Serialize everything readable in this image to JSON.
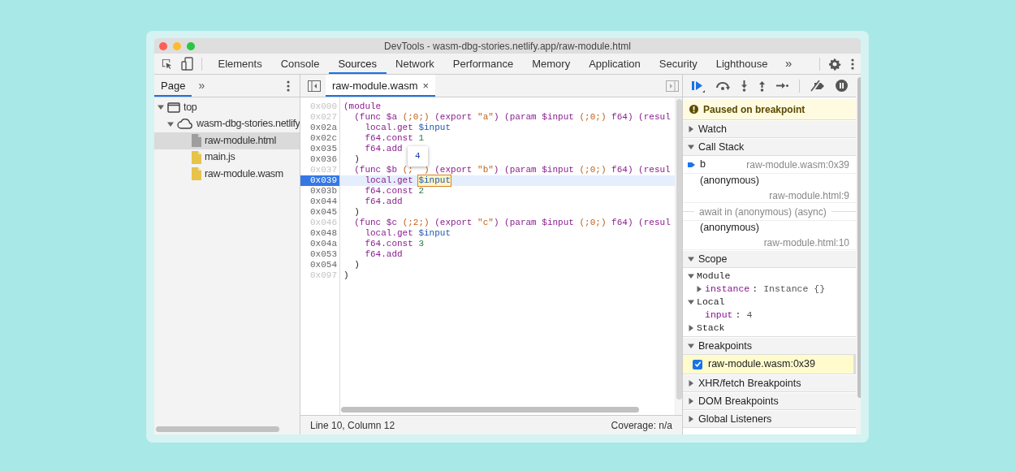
{
  "window": {
    "title": "DevTools - wasm-dbg-stories.netlify.app/raw-module.html"
  },
  "main_tabs": [
    {
      "label": "Elements",
      "selected": false
    },
    {
      "label": "Console",
      "selected": false
    },
    {
      "label": "Sources",
      "selected": true
    },
    {
      "label": "Network",
      "selected": false
    },
    {
      "label": "Performance",
      "selected": false
    },
    {
      "label": "Memory",
      "selected": false
    },
    {
      "label": "Application",
      "selected": false
    },
    {
      "label": "Security",
      "selected": false
    },
    {
      "label": "Lighthouse",
      "selected": false
    }
  ],
  "main_tabs_more": "»",
  "navigator": {
    "tabs": [
      {
        "label": "Page",
        "selected": true
      }
    ],
    "more": "»",
    "tree": [
      {
        "label": "top",
        "kind": "frame",
        "expanded": true,
        "selected": false,
        "children": [
          {
            "label": "wasm-dbg-stories.netlify",
            "kind": "domain",
            "expanded": true,
            "selected": false,
            "children": [
              {
                "label": "raw-module.html",
                "kind": "file",
                "color": "#9e9e9e",
                "selected": true
              },
              {
                "label": "main.js",
                "kind": "file",
                "color": "#e8c34a",
                "selected": false
              },
              {
                "label": "raw-module.wasm",
                "kind": "file",
                "color": "#e8c34a",
                "selected": false
              }
            ]
          }
        ]
      }
    ]
  },
  "editor": {
    "tabs": [
      {
        "label": "raw-module.wasm",
        "close": "×",
        "selected": true
      }
    ],
    "lines": [
      {
        "address": "0x000",
        "breakable": false,
        "current": false,
        "tokens": [
          {
            "text": "(module",
            "kind": "keyword"
          }
        ]
      },
      {
        "address": "0x027",
        "breakable": false,
        "current": false,
        "tokens": [
          {
            "text": "  (func $a ",
            "kind": "keyword"
          },
          {
            "text": "(;0;)",
            "kind": "string"
          },
          {
            "text": " (export ",
            "kind": "keyword"
          },
          {
            "text": "\"a\"",
            "kind": "string"
          },
          {
            "text": ") (param $input ",
            "kind": "keyword"
          },
          {
            "text": "(;0;)",
            "kind": "string"
          },
          {
            "text": " f64) (resul",
            "kind": "keyword"
          }
        ]
      },
      {
        "address": "0x02a",
        "breakable": true,
        "current": false,
        "tokens": [
          {
            "text": "    local.get ",
            "kind": "keyword"
          },
          {
            "text": "$input",
            "kind": "variable"
          }
        ]
      },
      {
        "address": "0x02c",
        "breakable": true,
        "current": false,
        "tokens": [
          {
            "text": "    f64.const ",
            "kind": "keyword"
          },
          {
            "text": "1",
            "kind": "number"
          }
        ]
      },
      {
        "address": "0x035",
        "breakable": true,
        "current": false,
        "tokens": [
          {
            "text": "    f64.add",
            "kind": "keyword"
          }
        ]
      },
      {
        "address": "0x036",
        "breakable": true,
        "current": false,
        "tokens": [
          {
            "text": "  )",
            "kind": "plain"
          }
        ]
      },
      {
        "address": "0x037",
        "breakable": false,
        "current": false,
        "tokens": [
          {
            "text": "  (func $b ",
            "kind": "keyword"
          },
          {
            "text": "(;",
            "kind": "string"
          },
          {
            "text": "4",
            "kind": "value_tooltip"
          },
          {
            "text": ")",
            "kind": "string"
          },
          {
            "text": " (export ",
            "kind": "keyword"
          },
          {
            "text": "\"b\"",
            "kind": "string"
          },
          {
            "text": ") (param $input ",
            "kind": "keyword"
          },
          {
            "text": "(;0;)",
            "kind": "string"
          },
          {
            "text": " f64) (resul",
            "kind": "keyword"
          }
        ]
      },
      {
        "address": "0x039",
        "breakable": true,
        "current": true,
        "tokens": [
          {
            "text": "    local.get ",
            "kind": "keyword"
          },
          {
            "text": "$input",
            "kind": "hovered"
          }
        ]
      },
      {
        "address": "0x03b",
        "breakable": true,
        "current": false,
        "tokens": [
          {
            "text": "    f64.const ",
            "kind": "keyword"
          },
          {
            "text": "2",
            "kind": "number"
          }
        ]
      },
      {
        "address": "0x044",
        "breakable": true,
        "current": false,
        "tokens": [
          {
            "text": "    f64.add",
            "kind": "keyword"
          }
        ]
      },
      {
        "address": "0x045",
        "breakable": true,
        "current": false,
        "tokens": [
          {
            "text": "  )",
            "kind": "plain"
          }
        ]
      },
      {
        "address": "0x046",
        "breakable": false,
        "current": false,
        "tokens": [
          {
            "text": "  (func $c ",
            "kind": "keyword"
          },
          {
            "text": "(;2;)",
            "kind": "string"
          },
          {
            "text": " (export ",
            "kind": "keyword"
          },
          {
            "text": "\"c\"",
            "kind": "string"
          },
          {
            "text": ") (param $input ",
            "kind": "keyword"
          },
          {
            "text": "(;0;)",
            "kind": "string"
          },
          {
            "text": " f64) (resul",
            "kind": "keyword"
          }
        ]
      },
      {
        "address": "0x048",
        "breakable": true,
        "current": false,
        "tokens": [
          {
            "text": "    local.get ",
            "kind": "keyword"
          },
          {
            "text": "$input",
            "kind": "variable"
          }
        ]
      },
      {
        "address": "0x04a",
        "breakable": true,
        "current": false,
        "tokens": [
          {
            "text": "    f64.const ",
            "kind": "keyword"
          },
          {
            "text": "3",
            "kind": "number"
          }
        ]
      },
      {
        "address": "0x053",
        "breakable": true,
        "current": false,
        "tokens": [
          {
            "text": "    f64.add",
            "kind": "keyword"
          }
        ]
      },
      {
        "address": "0x054",
        "breakable": true,
        "current": false,
        "tokens": [
          {
            "text": "  )",
            "kind": "plain"
          }
        ]
      },
      {
        "address": "0x097",
        "breakable": false,
        "current": false,
        "tokens": [
          {
            "text": ")",
            "kind": "plain"
          }
        ]
      }
    ],
    "status_bar": {
      "position": "Line 10, Column 12",
      "coverage": "Coverage: n/a"
    }
  },
  "debugger": {
    "paused_message": "Paused on breakpoint",
    "sections": [
      {
        "title": "Watch",
        "expanded": false
      },
      {
        "title": "Call Stack",
        "kind": "call_stack",
        "expanded": true,
        "frames": [
          {
            "kind": "frame",
            "name": "b",
            "location": "raw-module.wasm:0x39",
            "current": true
          },
          {
            "kind": "frame",
            "name": "(anonymous)",
            "location": "raw-module.html:9",
            "current": false
          },
          {
            "kind": "separator",
            "name": "await in (anonymous) (async)"
          },
          {
            "kind": "frame",
            "name": "(anonymous)",
            "location": "raw-module.html:10",
            "current": false
          }
        ]
      },
      {
        "title": "Scope",
        "kind": "scope",
        "expanded": true,
        "tree": [
          {
            "name": "Module",
            "expanded": true,
            "children": [
              {
                "name": "instance",
                "separator": ":",
                "value": "Instance {}",
                "expanded": false
              }
            ]
          },
          {
            "name": "Local",
            "expanded": true,
            "children": [
              {
                "name": "input",
                "separator": ":",
                "value": "4"
              }
            ]
          },
          {
            "name": "Stack",
            "expanded": false
          }
        ]
      },
      {
        "title": "Breakpoints",
        "kind": "breakpoints",
        "expanded": true,
        "items": [
          {
            "label": "raw-module.wasm:0x39",
            "checked": true,
            "hit": true
          }
        ]
      },
      {
        "title": "XHR/fetch Breakpoints",
        "expanded": false
      },
      {
        "title": "DOM Breakpoints",
        "expanded": false
      },
      {
        "title": "Global Listeners",
        "expanded": false
      }
    ]
  }
}
